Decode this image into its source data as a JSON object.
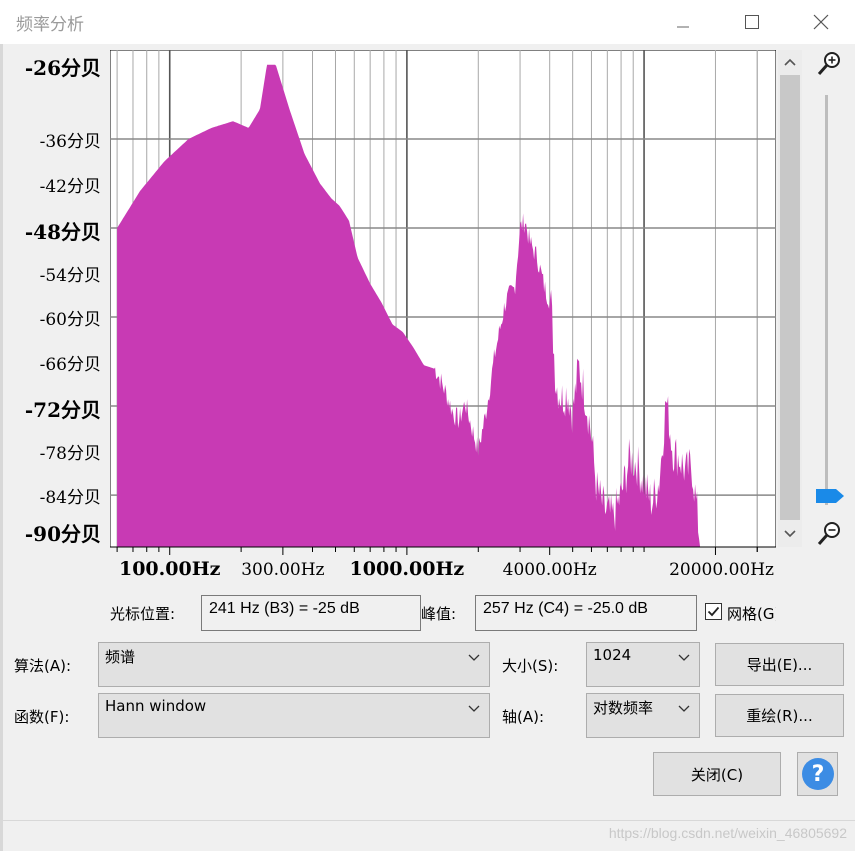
{
  "window": {
    "title": "频率分析"
  },
  "graph": {
    "y_ticks": [
      "-26分贝",
      "-36分贝",
      "-42分贝",
      "-48分贝",
      "-54分贝",
      "-60分贝",
      "-66分贝",
      "-72分贝",
      "-78分贝",
      "-84分贝",
      "-90分贝"
    ],
    "y_bold": [
      true,
      false,
      false,
      true,
      false,
      false,
      false,
      true,
      false,
      false,
      true
    ],
    "x_ticks": [
      "100.00Hz",
      "300.00Hz",
      "1000.00Hz",
      "4000.00Hz",
      "20000.00Hz"
    ],
    "x_bold": [
      true,
      false,
      true,
      false,
      false
    ],
    "fill_color": "#c83ab4",
    "spectrum_db": [
      [
        60,
        -48
      ],
      [
        75,
        -43
      ],
      [
        95,
        -39
      ],
      [
        120,
        -36
      ],
      [
        150,
        -34.5
      ],
      [
        185,
        -33.6
      ],
      [
        215,
        -34.5
      ],
      [
        240,
        -32
      ],
      [
        257,
        -26
      ],
      [
        280,
        -26
      ],
      [
        320,
        -32
      ],
      [
        370,
        -38
      ],
      [
        430,
        -42
      ],
      [
        480,
        -44
      ],
      [
        520,
        -45
      ],
      [
        570,
        -47
      ],
      [
        620,
        -52
      ],
      [
        700,
        -55.5
      ],
      [
        780,
        -58
      ],
      [
        870,
        -61
      ],
      [
        960,
        -62
      ],
      [
        1060,
        -64
      ],
      [
        1180,
        -66.5
      ],
      [
        1320,
        -67
      ],
      [
        1450,
        -70
      ],
      [
        1570,
        -73
      ],
      [
        1660,
        -74
      ],
      [
        1760,
        -71.5
      ],
      [
        1880,
        -75
      ],
      [
        2000,
        -78
      ],
      [
        2150,
        -73
      ],
      [
        2350,
        -65
      ],
      [
        2600,
        -58
      ],
      [
        2850,
        -56
      ],
      [
        3000,
        -48
      ],
      [
        3150,
        -47
      ],
      [
        3300,
        -50
      ],
      [
        3550,
        -52
      ],
      [
        3800,
        -56
      ],
      [
        4050,
        -58
      ],
      [
        4250,
        -69
      ],
      [
        4500,
        -71
      ],
      [
        4750,
        -70
      ],
      [
        5000,
        -73
      ],
      [
        5300,
        -66.5
      ],
      [
        5600,
        -70
      ],
      [
        5950,
        -75
      ],
      [
        6300,
        -83
      ],
      [
        6800,
        -86
      ],
      [
        7400,
        -87
      ],
      [
        8000,
        -84
      ],
      [
        8700,
        -79
      ],
      [
        9400,
        -80
      ],
      [
        10100,
        -83
      ],
      [
        10800,
        -85
      ],
      [
        11600,
        -82
      ],
      [
        12400,
        -71
      ],
      [
        13200,
        -78
      ],
      [
        14100,
        -79
      ],
      [
        15000,
        -81
      ],
      [
        15900,
        -80
      ],
      [
        16700,
        -86
      ],
      [
        17300,
        -91
      ]
    ]
  },
  "controls": {
    "cursor_label": "光标位置:",
    "cursor_value": "241 Hz (B3) = -25 dB",
    "peak_label": "峰值:",
    "peak_value": "257 Hz (C4) = -25.0 dB",
    "grid_label": "网格(G)",
    "grid_checked": true,
    "algorithm_label": "算法(A):",
    "algorithm_value": "频谱",
    "size_label": "大小(S):",
    "size_value": "1024",
    "export_button": "导出(E)...",
    "function_label": "函数(F):",
    "function_value": "Hann window",
    "axis_label": "轴(A):",
    "axis_value": "对数频率",
    "replot_button": "重绘(R)...",
    "close_button": "关闭(C)",
    "help_icon": "?"
  },
  "watermark": "https://blog.csdn.net/weixin_46805692"
}
